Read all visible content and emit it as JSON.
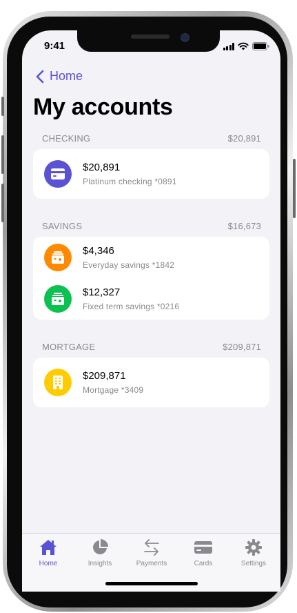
{
  "status_bar": {
    "time": "9:41"
  },
  "nav": {
    "back_label": "Home"
  },
  "page": {
    "title": "My accounts"
  },
  "colors": {
    "accent": "#5a52d5",
    "checking": "#5a52d5",
    "savings_everyday": "#ff8a00",
    "savings_fixed": "#0bc251",
    "mortgage": "#ffcc00"
  },
  "sections": [
    {
      "label": "CHECKING",
      "total": "$20,891",
      "accounts": [
        {
          "amount": "$20,891",
          "desc": "Platinum checking *0891",
          "icon": "credit-card-icon"
        }
      ]
    },
    {
      "label": "SAVINGS",
      "total": "$16,673",
      "accounts": [
        {
          "amount": "$4,346",
          "desc": "Everyday savings *1842",
          "icon": "savings-box-icon"
        },
        {
          "amount": "$12,327",
          "desc": "Fixed term savings *0216",
          "icon": "savings-box-icon"
        }
      ]
    },
    {
      "label": "MORTGAGE",
      "total": "$209,871",
      "accounts": [
        {
          "amount": "$209,871",
          "desc": "Mortgage *3409",
          "icon": "building-icon"
        }
      ]
    }
  ],
  "tabbar": {
    "tabs": [
      {
        "label": "Home",
        "icon": "home-icon",
        "active": true
      },
      {
        "label": "Insights",
        "icon": "pie-chart-icon",
        "active": false
      },
      {
        "label": "Payments",
        "icon": "transfer-arrows-icon",
        "active": false
      },
      {
        "label": "Cards",
        "icon": "credit-card-icon",
        "active": false
      },
      {
        "label": "Settings",
        "icon": "gear-icon",
        "active": false
      }
    ]
  }
}
